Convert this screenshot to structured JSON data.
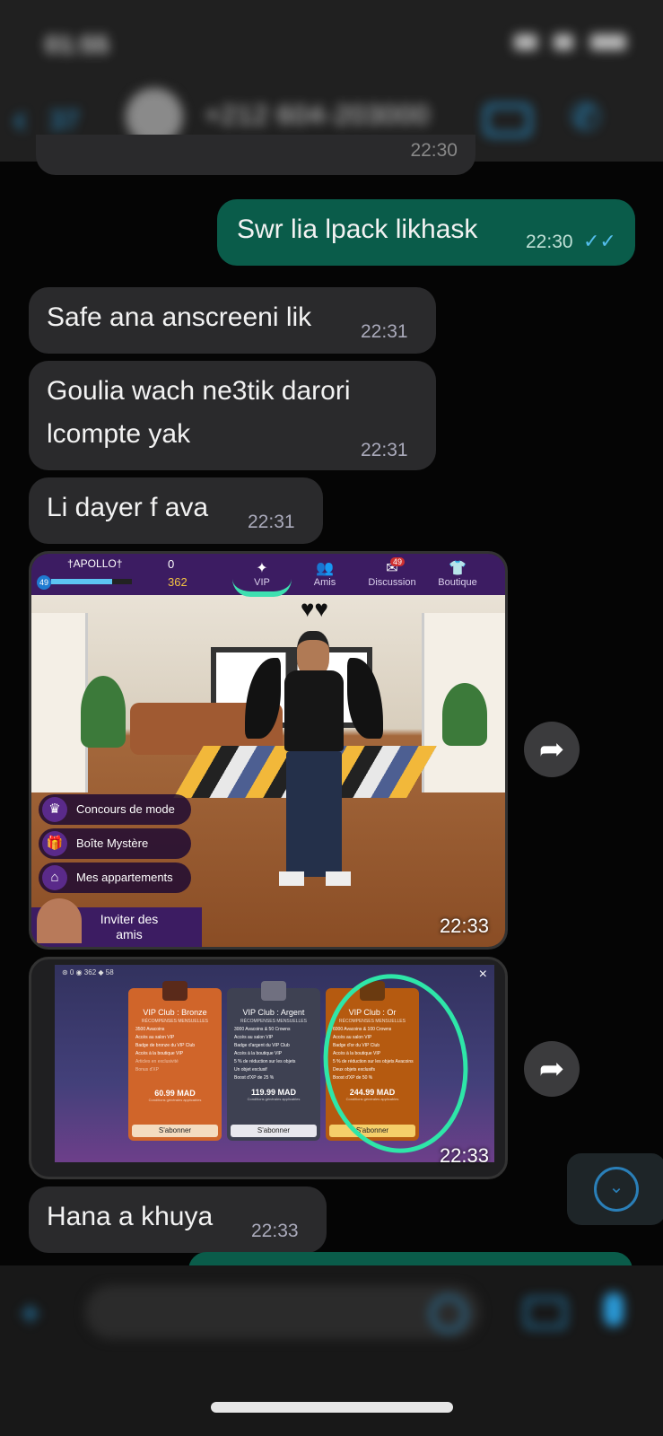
{
  "status_bar": {
    "time": "01:55"
  },
  "header": {
    "back_count": "37",
    "contact_name": "+212 604-203000"
  },
  "partial_top_time": "22:30",
  "messages": [
    {
      "dir": "out",
      "text": "Swr lia lpack likhask",
      "time": "22:30",
      "ticks": "✓✓"
    },
    {
      "dir": "in",
      "text": "Safe ana anscreeni lik",
      "time": "22:31"
    },
    {
      "dir": "in",
      "text_line1": "Goulia wach ne3tik darori",
      "text_line2": "lcompte yak",
      "time": "22:31"
    },
    {
      "dir": "in",
      "text": "Li dayer f ava",
      "time": "22:31"
    },
    {
      "dir": "in",
      "text": "Hana a khuya",
      "time": "22:33"
    }
  ],
  "image1": {
    "time": "22:33",
    "player": "†APOLLO†",
    "level": "49",
    "gems": "0",
    "coins": "362",
    "level_progress": 0.75,
    "nav": [
      {
        "icon": "✦",
        "label": "VIP"
      },
      {
        "icon": "👥",
        "label": "Amis"
      },
      {
        "icon": "✉",
        "label": "Discussion",
        "badge": "49"
      },
      {
        "icon": "👕",
        "label": "Boutique"
      }
    ],
    "menu": [
      {
        "icon": "♛",
        "label": "Concours de mode"
      },
      {
        "icon": "🎁",
        "label": "Boîte Mystère"
      },
      {
        "icon": "⌂",
        "label": "Mes appartements"
      }
    ],
    "invite_label": "Inviter des amis"
  },
  "image2": {
    "time": "22:33",
    "close": "×",
    "top_stats": "⊛ 0  ◉ 362  ◆ 58",
    "cards": [
      {
        "title": "VIP Club : Bronze",
        "sub": "RÉCOMPENSES MENSUELLES",
        "color": "#d0652a",
        "features": [
          "3500 Avacoins",
          "Accès au salon VIP",
          "Badge de bronze du VIP Club",
          "Accès à la boutique VIP",
          "Articles en exclusivité",
          "Bonus d'XP"
        ],
        "price": "60.99 MAD",
        "cond": "Conditions générales applicables",
        "button": "S'abonner"
      },
      {
        "title": "VIP Club : Argent",
        "sub": "RÉCOMPENSES MENSUELLES",
        "color": "#3e4152",
        "features": [
          "3000 Avacoins & 50 Crowns",
          "Accès au salon VIP",
          "Badge d'argent du VIP Club",
          "Accès à la boutique VIP",
          "5 % de réduction sur les objets",
          "Un objet exclusif",
          "Boost d'XP de 25 %"
        ],
        "price": "119.99 MAD",
        "cond": "Conditions générales applicables",
        "button": "S'abonner"
      },
      {
        "title": "VIP Club : Or",
        "sub": "RÉCOMPENSES MENSUELLES",
        "color": "#b55a10",
        "features": [
          "6000 Avacoins & 100 Crowns",
          "Accès au salon VIP",
          "Badge d'or du VIP Club",
          "Accès à la boutique VIP",
          "5 % de réduction sur les objets Avacoins",
          "Deux objets exclusifs",
          "Boost d'XP de 50 %"
        ],
        "price": "244.99 MAD",
        "cond": "Conditions générales applicables",
        "button": "S'abonner"
      }
    ]
  },
  "forward_icon": "➦",
  "scroll_down_icon": "⌄",
  "bottom_bar": {
    "attach_icon": "+"
  },
  "colors": {
    "outgoing": "#0a5c4a",
    "incoming": "#2a2a2c",
    "accent": "#2a9ad8",
    "highlight": "#2ee6a8"
  }
}
